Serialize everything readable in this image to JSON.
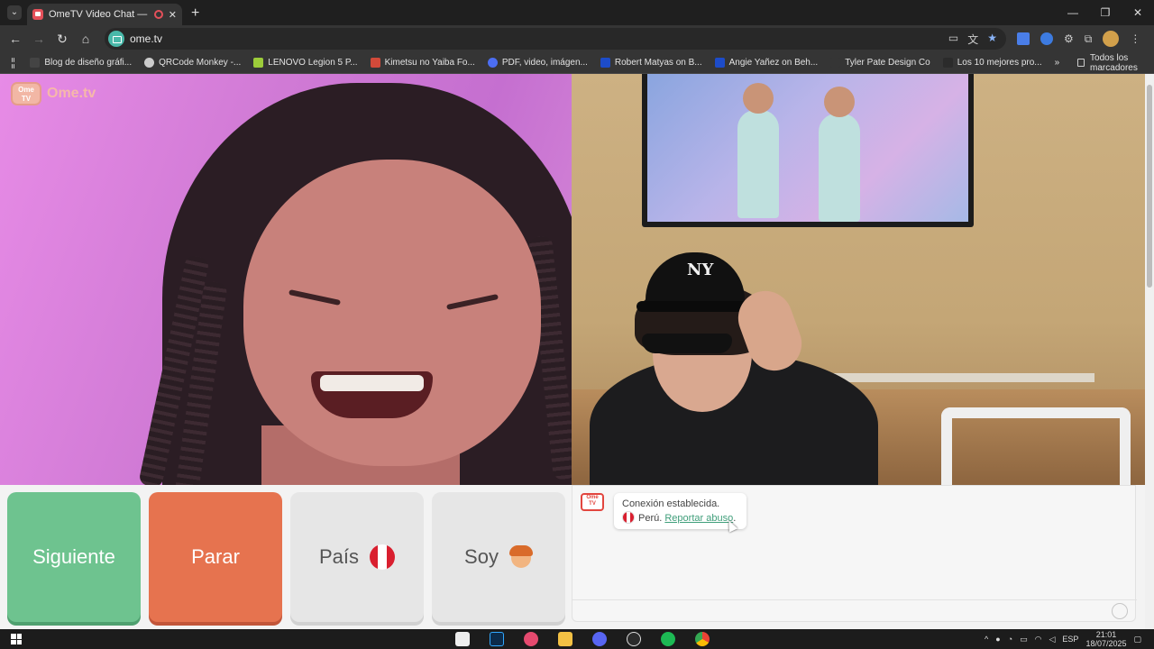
{
  "browser": {
    "tab_title": "OmeTV Video Chat — Ome",
    "new_tab_symbol": "+",
    "url": "ome.tv",
    "bookmarks": [
      "Blog de diseño gráfi...",
      "QRCode Monkey -...",
      "LENOVO Legion 5 P...",
      "Kimetsu no Yaiba Fo...",
      "PDF, video, imágen...",
      "Robert Matyas on B...",
      "Angie Yañez on Beh...",
      "Tyler Pate Design Co",
      "Los 10 mejores pro..."
    ],
    "bookmarks_overflow": "»",
    "all_bookmarks": "Todos los marcadores"
  },
  "site": {
    "logo_badge": "Ome TV",
    "logo_text": "Ome.tv"
  },
  "controls": {
    "next": "Siguiente",
    "stop": "Parar",
    "country": "País",
    "gender": "Soy"
  },
  "chat": {
    "logo": "Ome TV",
    "status": "Conexión establecida.",
    "country": "Perú.",
    "report": "Reportar abuso",
    "report_end": "."
  },
  "taskbar": {
    "language": "ESP",
    "time": "21:01",
    "date": "18/07/2025"
  },
  "colors": {
    "next_button": "#6ec38f",
    "stop_button": "#e6734f",
    "report_link": "#3f9e7a"
  }
}
